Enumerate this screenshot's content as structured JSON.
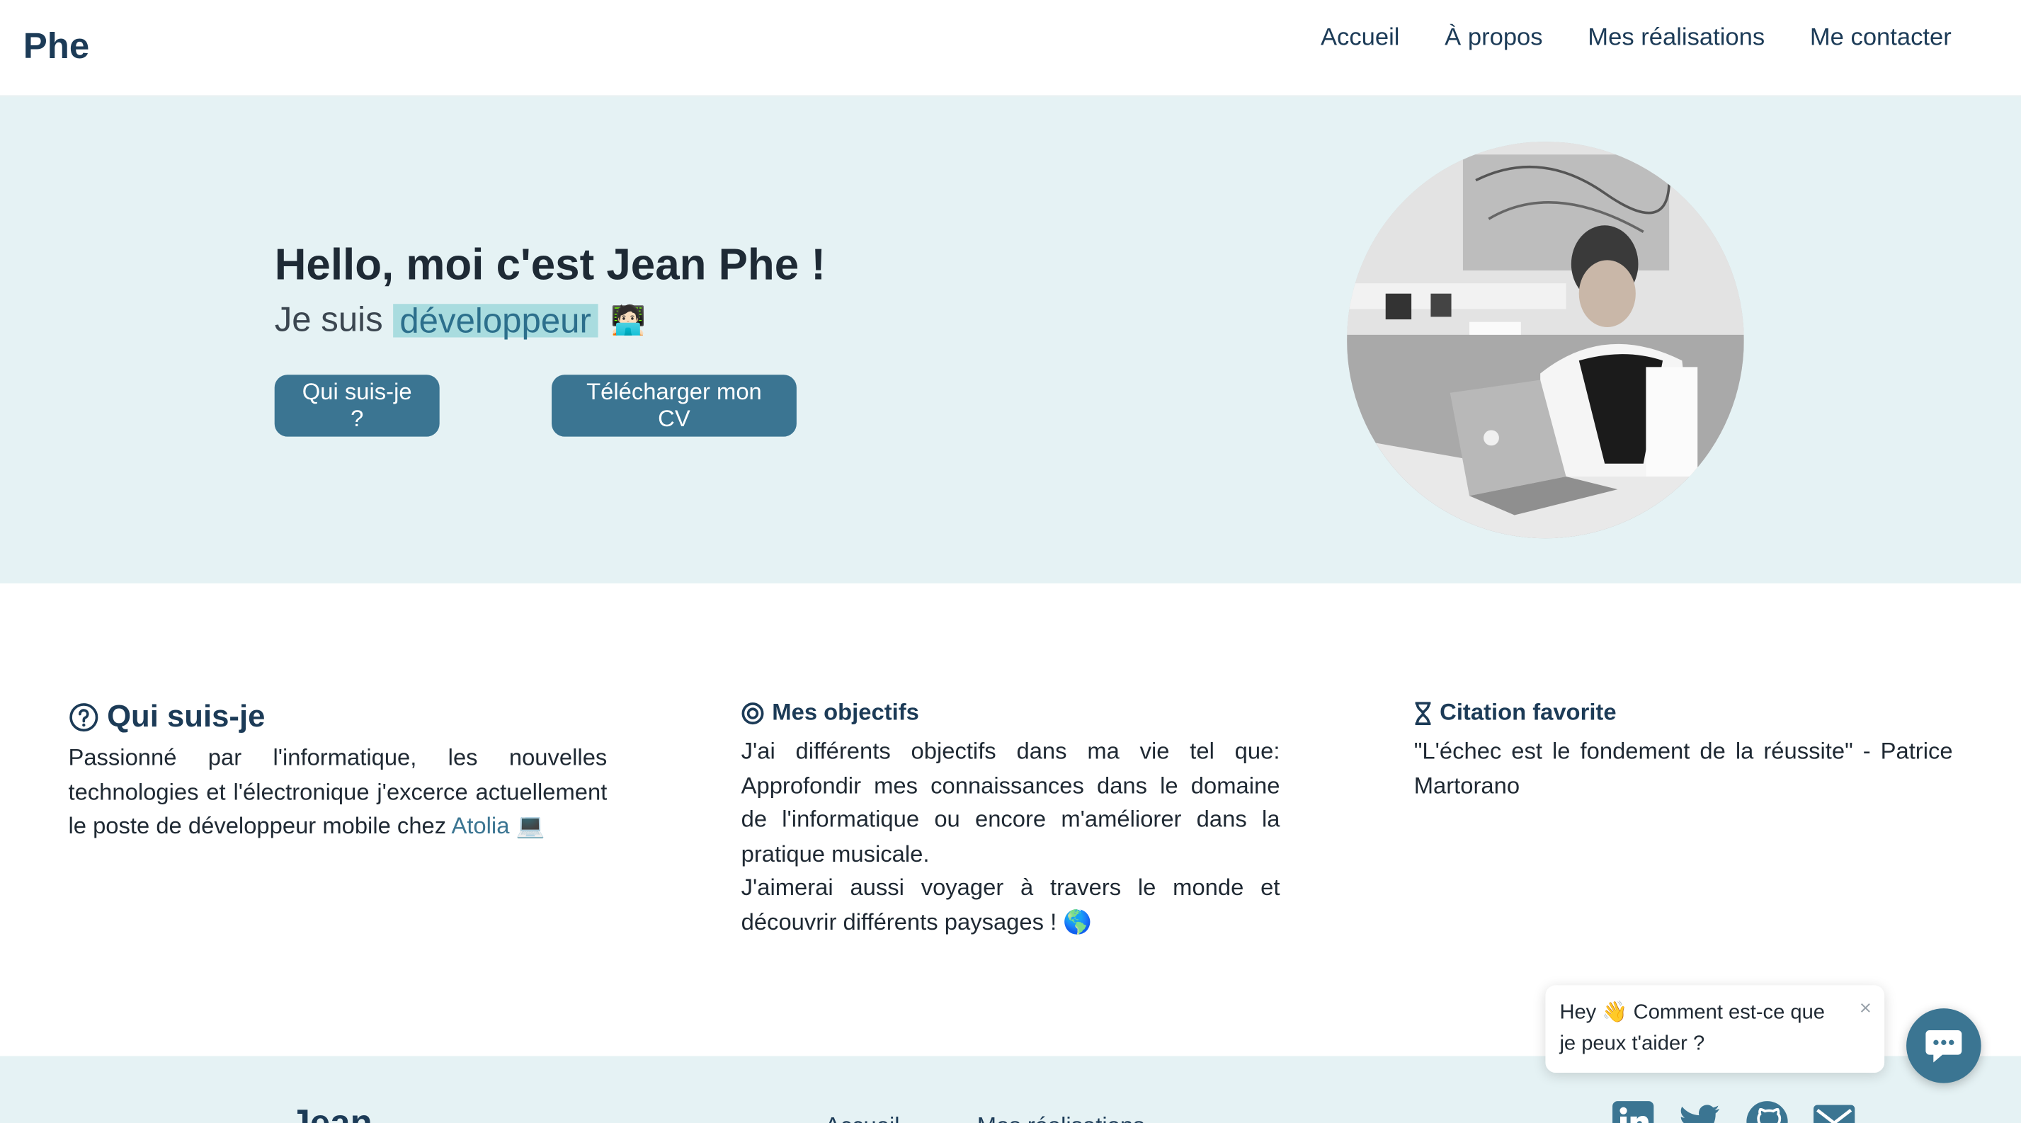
{
  "nav": {
    "brand": "Phe",
    "links": [
      "Accueil",
      "À propos",
      "Mes réalisations",
      "Me contacter"
    ]
  },
  "hero": {
    "title": "Hello, moi c'est Jean Phe !",
    "prefix": "Je suis",
    "role": "développeur",
    "role_emoji": "🧑🏻‍💻",
    "btn_who": "Qui suis-je ?",
    "btn_cv": "Télécharger mon CV"
  },
  "about": {
    "who": {
      "title": "Qui suis-je",
      "text": "Passionné par l'informatique, les nouvelles technologies et l'électronique j'excerce actuellement le poste de développeur mobile chez",
      "link": "Atolia",
      "emoji": "💻"
    },
    "goals": {
      "title": "Mes objectifs",
      "text1": "J'ai différents objectifs dans ma vie tel que: Approfondir mes connaissances dans le domaine de l'informatique ou encore m'améliorer dans la pratique musicale.",
      "text2": "J'aimerai aussi voyager à travers le monde et découvrir différents paysages !",
      "emoji": "🌎"
    },
    "quote": {
      "title": "Citation favorite",
      "text": "\"L'échec est le fondement de la réussite\" - Patrice Martorano"
    }
  },
  "footer": {
    "brand": "Jean",
    "links": [
      "Accueil",
      "Mes réalisations"
    ],
    "socials": [
      "linkedin-icon",
      "twitter-icon",
      "github-icon",
      "mail-icon"
    ]
  },
  "chat": {
    "greeting": "Hey 👋  Comment est-ce que je peux t'aider ?",
    "close": "×"
  },
  "colors": {
    "brand": "#1c3b57",
    "accent": "#3b7592",
    "hero_bg": "#e5f2f4",
    "highlight": "#a9dcdf"
  }
}
